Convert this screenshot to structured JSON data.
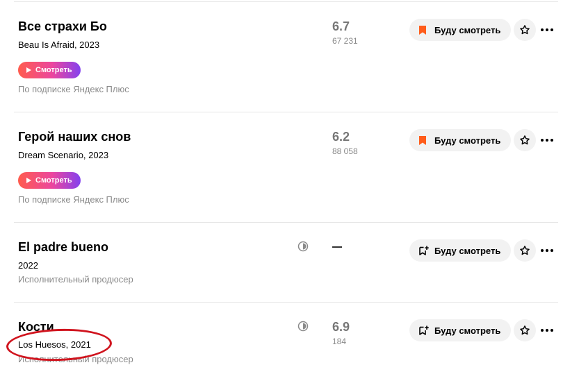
{
  "colors": {
    "accent_orange": "#ff5c1a",
    "watch_gradient": [
      "#ff5c4d",
      "#eb469f",
      "#8341ef"
    ],
    "annotation_red": "#d0141e"
  },
  "icons": {
    "bookmark": "bookmark-icon",
    "add_bookmark": "add-bookmark-icon",
    "star": "star-icon",
    "more": "more-icon",
    "half_circle": "half-circle-icon",
    "play": "play-icon"
  },
  "movies": [
    {
      "title": "Все страхи Бо",
      "subtitle": "Beau Is Afraid, 2023",
      "watch_label": "Смотреть",
      "availability": "По подписке Яндекс Плюс",
      "rating": "6.7",
      "votes": "67 231",
      "will_watch_label": "Буду смотреть"
    },
    {
      "title": "Герой наших снов",
      "subtitle": "Dream Scenario, 2023",
      "watch_label": "Смотреть",
      "availability": "По подписке Яндекс Плюс",
      "rating": "6.2",
      "votes": "88 058",
      "will_watch_label": "Буду смотреть"
    },
    {
      "title": "El padre bueno",
      "subtitle": "2022",
      "role": "Исполнительный продюсер",
      "rating": "—",
      "will_watch_label": "Буду смотреть"
    },
    {
      "title": "Кости",
      "subtitle": "Los Huesos, 2021",
      "role": "Исполнительный продюсер",
      "rating": "6.9",
      "votes": "184",
      "will_watch_label": "Буду смотреть"
    }
  ]
}
